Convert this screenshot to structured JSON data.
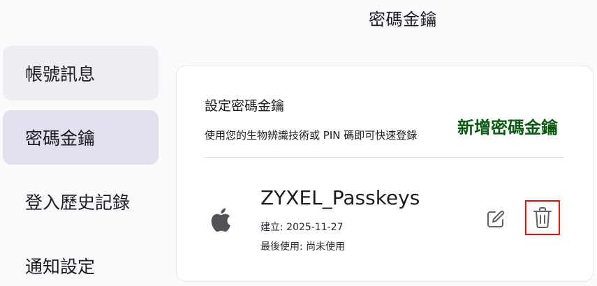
{
  "header": {
    "title": "密碼金鑰"
  },
  "sidebar": {
    "items": [
      {
        "label": "帳號訊息"
      },
      {
        "label": "密碼金鑰"
      },
      {
        "label": "登入歷史記錄"
      },
      {
        "label": "通知設定"
      }
    ]
  },
  "main": {
    "section_title": "設定密碼金鑰",
    "section_description": "使用您的生物辨識技術或 PIN 碼即可快速登錄",
    "add_button_label": "新增密碼金鑰",
    "passkeys": [
      {
        "icon": "apple-icon",
        "name": "ZYXEL_Passkeys",
        "created": "建立: 2025-11-27",
        "last_used": "最後使用: 尚未使用",
        "actions": [
          "pencil-icon",
          "trash-icon"
        ]
      }
    ]
  },
  "colors": {
    "add_button": "#0b5a12",
    "delete_highlight": "#e01414",
    "sidebar_active": "#e4dfee"
  }
}
